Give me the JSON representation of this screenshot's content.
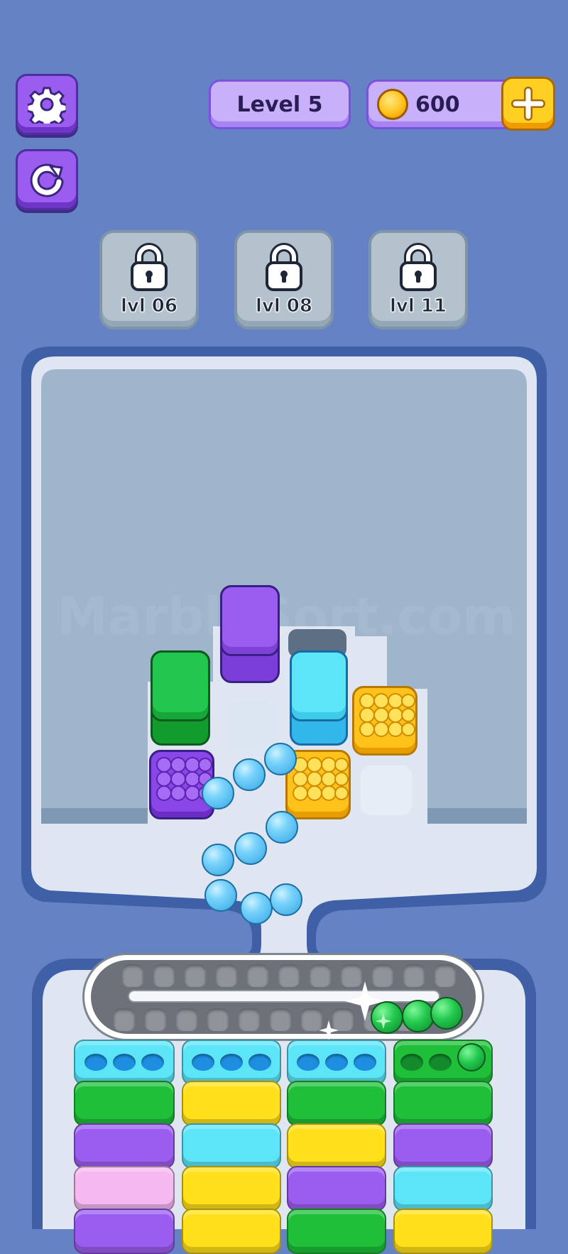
{
  "hud": {
    "level_label": "Level 5",
    "coins": "600",
    "settings_icon": "gear-icon",
    "restart_icon": "restart-icon",
    "add_icon": "plus-icon",
    "coin_icon": "coin-icon"
  },
  "locked_slots": [
    {
      "label": "lvl 06",
      "icon": "lock-icon"
    },
    {
      "label": "lvl 08",
      "icon": "lock-icon"
    },
    {
      "label": "lvl 11",
      "icon": "lock-icon"
    }
  ],
  "watermark": "MarbleSort.com",
  "colors": {
    "background": "#6582c4",
    "purple": "#9b5df0",
    "green": "#1fbf3a",
    "cyan": "#5ce4f7",
    "yellow": "#ffd21a",
    "pink": "#f5b8f0",
    "coin_gold": "#ffc21a"
  },
  "board": {
    "blocks": [
      {
        "color": "green",
        "kind": "stack"
      },
      {
        "color": "purple",
        "kind": "stack"
      },
      {
        "color": "cyan",
        "kind": "stack"
      },
      {
        "color": "yellow",
        "kind": "marbles"
      },
      {
        "color": "purple",
        "kind": "marbles"
      },
      {
        "color": "yellow",
        "kind": "marbles"
      }
    ],
    "falling_balls_color": "cyan"
  },
  "conveyor": {
    "balls_color": "green",
    "ball_count": 3
  },
  "bins": [
    {
      "layers": [
        "cyan",
        "green",
        "purple",
        "pink",
        "purple"
      ]
    },
    {
      "layers": [
        "cyan",
        "yellow",
        "cyan",
        "yellow",
        "yellow"
      ]
    },
    {
      "layers": [
        "cyan",
        "green",
        "yellow",
        "purple",
        "green"
      ]
    },
    {
      "layers": [
        "green",
        "green",
        "purple",
        "cyan",
        "yellow"
      ]
    }
  ]
}
